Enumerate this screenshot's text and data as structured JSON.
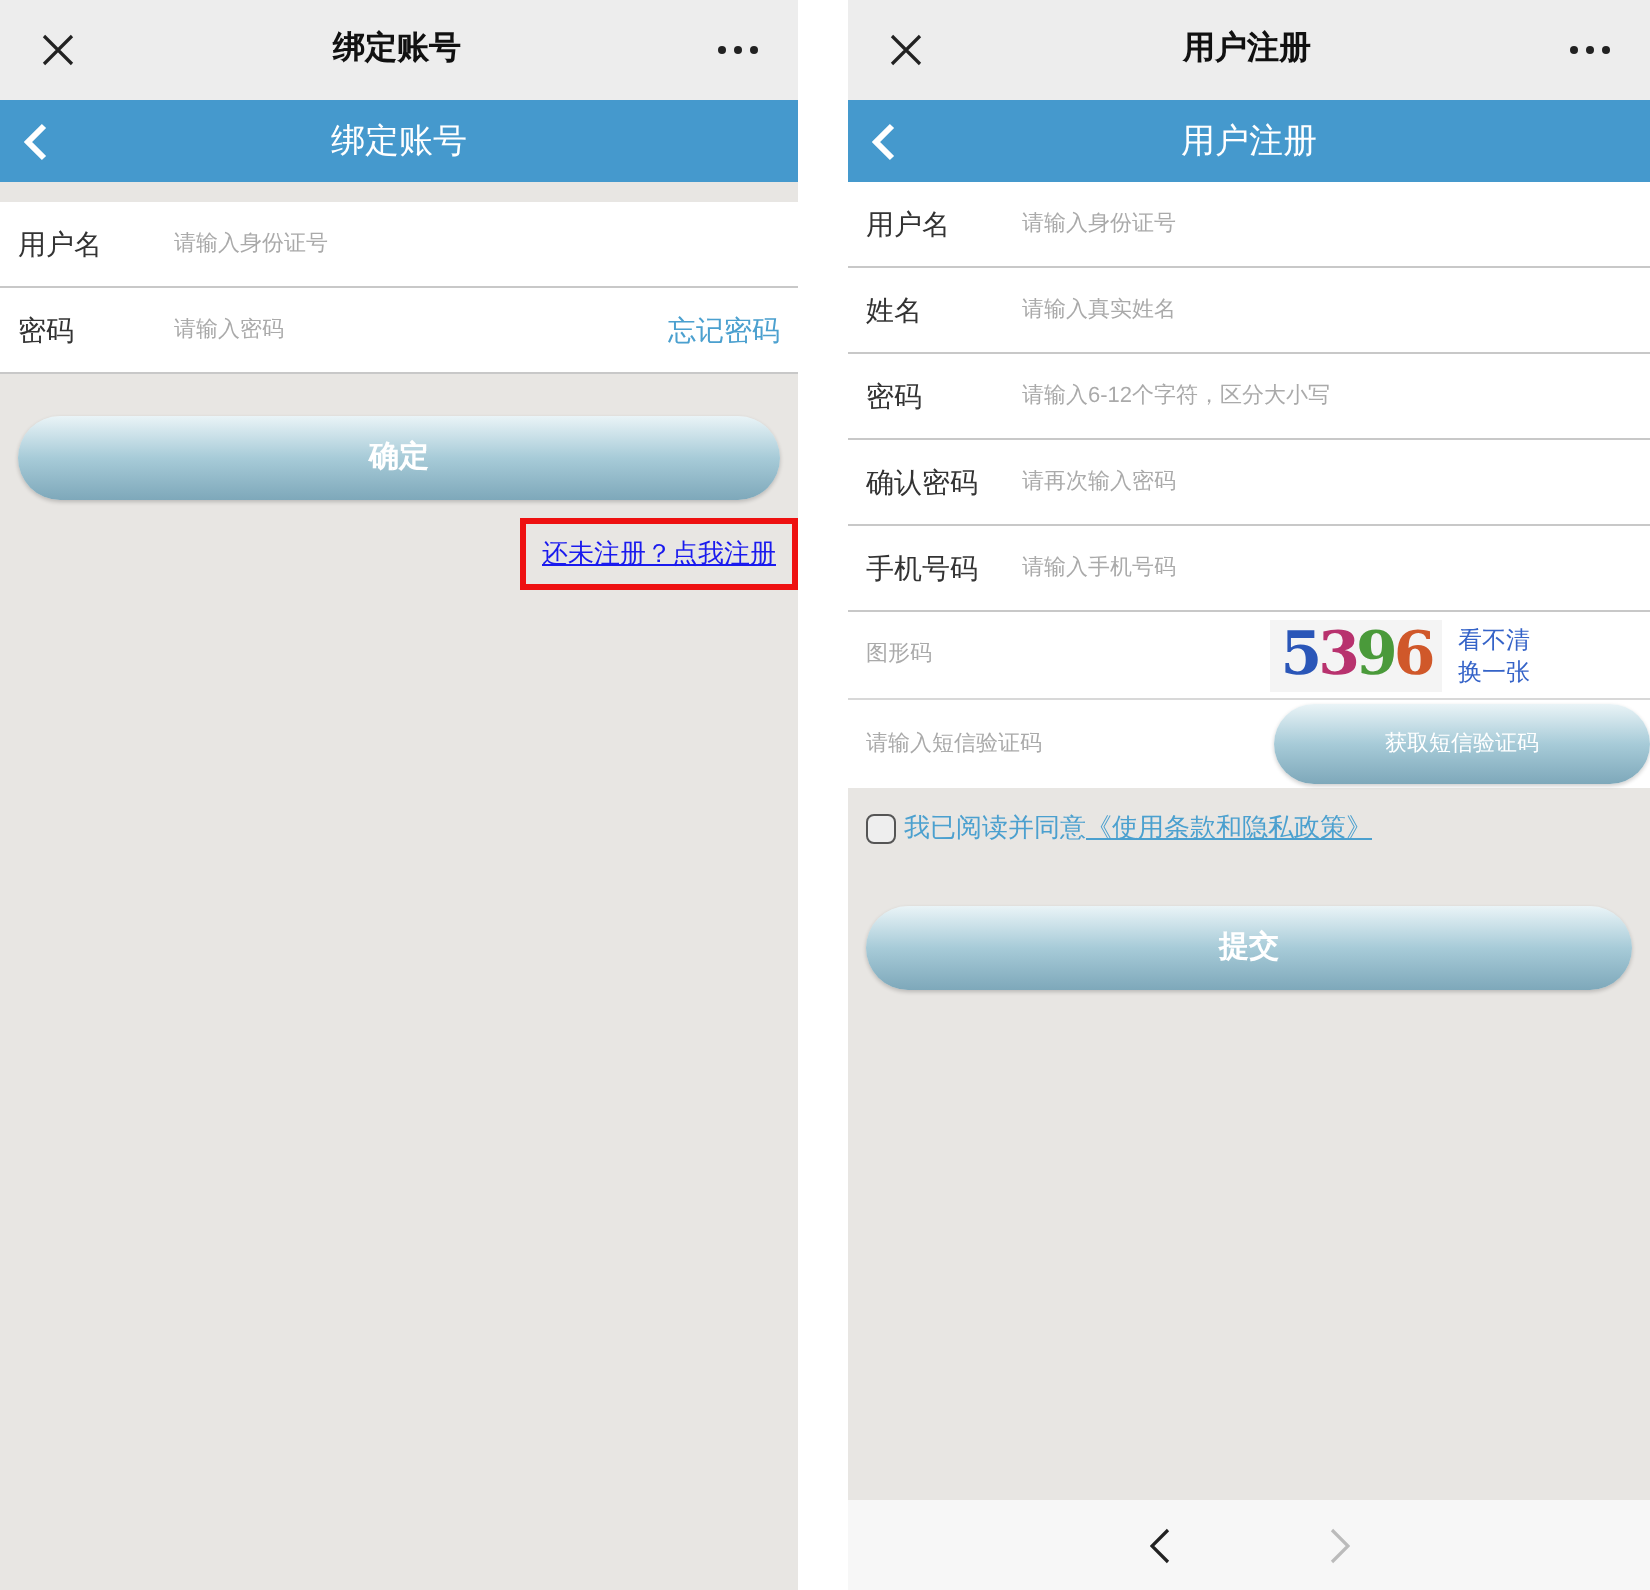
{
  "screens": [
    {
      "topbar": {
        "title": "绑定账号"
      },
      "header": {
        "title": "绑定账号"
      },
      "fields": [
        {
          "label": "用户名",
          "placeholder": "请输入身份证号"
        },
        {
          "label": "密码",
          "placeholder": "请输入密码",
          "link": "忘记密码"
        }
      ],
      "button": "确定",
      "register_link": {
        "text": "还未注册？点我注册",
        "highlighted": true
      }
    },
    {
      "topbar": {
        "title": "用户注册"
      },
      "header": {
        "title": "用户注册"
      },
      "fields": [
        {
          "label": "用户名",
          "placeholder": "请输入身份证号"
        },
        {
          "label": "姓名",
          "placeholder": "请输入真实姓名"
        },
        {
          "label": "密码",
          "placeholder": "请输入6-12个字符，区分大小写"
        },
        {
          "label": "确认密码",
          "placeholder": "请再次输入密码"
        },
        {
          "label": "手机号码",
          "placeholder": "请输入手机号码"
        }
      ],
      "captcha": {
        "placeholder": "图形码",
        "code": "5396",
        "refresh": [
          "看不清",
          "换一张"
        ]
      },
      "sms": {
        "placeholder": "请输入短信验证码",
        "button": "获取短信验证码"
      },
      "agreement": {
        "checked": false,
        "prefix": "我已阅读并同意",
        "link": "《使用条款和隐私政策》"
      },
      "button": "提交",
      "nav": {
        "back": {
          "disabled": false
        },
        "forward": {
          "disabled": true
        }
      }
    }
  ]
}
